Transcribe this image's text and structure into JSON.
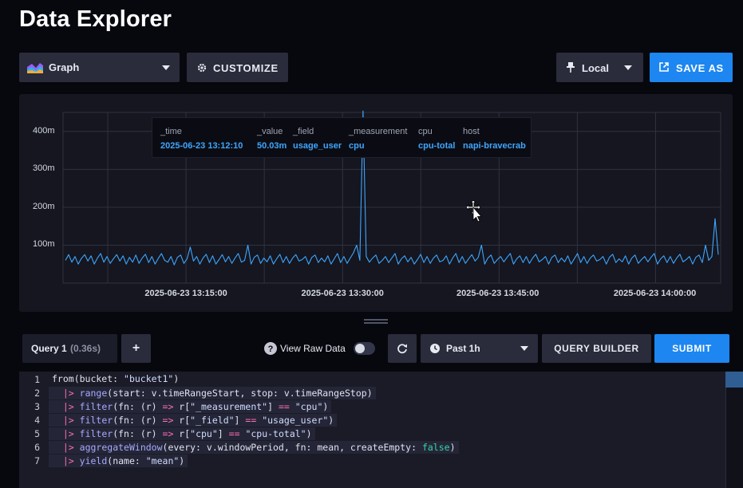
{
  "page": {
    "title": "Data Explorer"
  },
  "toolbar": {
    "graph_label": "Graph",
    "customize_label": "CUSTOMIZE",
    "local_label": "Local",
    "save_as_label": "SAVE AS"
  },
  "chart_data": {
    "type": "line",
    "ylim": [
      0,
      450
    ],
    "y_ticks": [
      {
        "value": 100,
        "label": "100m"
      },
      {
        "value": 200,
        "label": "200m"
      },
      {
        "value": 300,
        "label": "300m"
      },
      {
        "value": 400,
        "label": "400m"
      }
    ],
    "x_ticks": [
      {
        "value": 0.187,
        "label": "2025-06-23 13:15:00"
      },
      {
        "value": 0.425,
        "label": "2025-06-23 13:30:00"
      },
      {
        "value": 0.661,
        "label": "2025-06-23 13:45:00"
      },
      {
        "value": 0.9,
        "label": "2025-06-23 14:00:00"
      }
    ],
    "series": [
      {
        "color": "#3ea6ff",
        "values": [
          60,
          75,
          55,
          70,
          50,
          65,
          75,
          58,
          72,
          50,
          66,
          78,
          55,
          70,
          52,
          64,
          75,
          58,
          72,
          50,
          68,
          55,
          74,
          52,
          66,
          76,
          54,
          70,
          50,
          65,
          78,
          60,
          55,
          70,
          48,
          68,
          74,
          52,
          64,
          95,
          58,
          70,
          50,
          66,
          76,
          54,
          72,
          50,
          62,
          75,
          56,
          70,
          52,
          66,
          78,
          55,
          60,
          100,
          50,
          68,
          74,
          52,
          66,
          56,
          72,
          50,
          64,
          76,
          54,
          70,
          52,
          66,
          75,
          58,
          62,
          70,
          50,
          68,
          74,
          54,
          66,
          56,
          72,
          50,
          64,
          78,
          54,
          70,
          52,
          66,
          80,
          100,
          60,
          470,
          70,
          55,
          66,
          74,
          52,
          60,
          70,
          54,
          66,
          78,
          50,
          64,
          72,
          56,
          68,
          50,
          62,
          76,
          54,
          70,
          52,
          66,
          74,
          56,
          60,
          72,
          50,
          66,
          78,
          54,
          70,
          52,
          64,
          75,
          58,
          68,
          100,
          50,
          66,
          74,
          52,
          62,
          70,
          56,
          68,
          78,
          50,
          64,
          72,
          54,
          70,
          52,
          66,
          76,
          56,
          62,
          70,
          50,
          68,
          74,
          54,
          66,
          56,
          72,
          50,
          64,
          78,
          54,
          70,
          52,
          66,
          74,
          58,
          62,
          70,
          50,
          68,
          76,
          54,
          64,
          56,
          72,
          50,
          66,
          74,
          52,
          62,
          70,
          56,
          68,
          78,
          50,
          64,
          72,
          54,
          70,
          52,
          66,
          76,
          56,
          62,
          70,
          50,
          68,
          74,
          54,
          100,
          60,
          70,
          170,
          75
        ]
      }
    ]
  },
  "tooltip": {
    "columns": [
      {
        "header": "_time",
        "value": "2025-06-23 13:12:10"
      },
      {
        "header": "_value",
        "value": "50.03m"
      },
      {
        "header": "_field",
        "value": "usage_user"
      },
      {
        "header": "_measurement",
        "value": "cpu"
      },
      {
        "header": "cpu",
        "value": "cpu-total"
      },
      {
        "header": "host",
        "value": "napi-bravecrab"
      }
    ]
  },
  "query_bar": {
    "tab_label": "Query 1",
    "tab_time": "(0.36s)",
    "add_label": "+",
    "view_raw_label": "View Raw Data",
    "time_range_label": "Past 1h",
    "query_builder_label": "QUERY BUILDER",
    "submit_label": "SUBMIT"
  },
  "editor": {
    "lines": [
      {
        "num": "1",
        "tokens": [
          [
            "k-plain",
            "from(bucket: "
          ],
          [
            "k-str",
            "\"bucket1\""
          ],
          [
            "k-plain",
            ")"
          ]
        ]
      },
      {
        "num": "2",
        "tokens": [
          [
            "k-dots",
            "  "
          ],
          [
            "k-op",
            "|>"
          ],
          [
            "k-plain",
            " "
          ],
          [
            "k-fn",
            "range"
          ],
          [
            "k-plain",
            "(start: v.timeRangeStart, stop: v.timeRangeStop)"
          ]
        ]
      },
      {
        "num": "3",
        "tokens": [
          [
            "k-dots",
            "  "
          ],
          [
            "k-op",
            "|>"
          ],
          [
            "k-plain",
            " "
          ],
          [
            "k-fn",
            "filter"
          ],
          [
            "k-plain",
            "(fn: (r) "
          ],
          [
            "k-op",
            "=>"
          ],
          [
            "k-plain",
            " r["
          ],
          [
            "k-str",
            "\"_measurement\""
          ],
          [
            "k-plain",
            "] "
          ],
          [
            "k-op",
            "=="
          ],
          [
            "k-plain",
            " "
          ],
          [
            "k-str",
            "\"cpu\""
          ],
          [
            "k-plain",
            ")"
          ]
        ]
      },
      {
        "num": "4",
        "tokens": [
          [
            "k-dots",
            "  "
          ],
          [
            "k-op",
            "|>"
          ],
          [
            "k-plain",
            " "
          ],
          [
            "k-fn",
            "filter"
          ],
          [
            "k-plain",
            "(fn: (r) "
          ],
          [
            "k-op",
            "=>"
          ],
          [
            "k-plain",
            " r["
          ],
          [
            "k-str",
            "\"_field\""
          ],
          [
            "k-plain",
            "] "
          ],
          [
            "k-op",
            "=="
          ],
          [
            "k-plain",
            " "
          ],
          [
            "k-str",
            "\"usage_user\""
          ],
          [
            "k-plain",
            ")"
          ]
        ]
      },
      {
        "num": "5",
        "tokens": [
          [
            "k-dots",
            "  "
          ],
          [
            "k-op",
            "|>"
          ],
          [
            "k-plain",
            " "
          ],
          [
            "k-fn",
            "filter"
          ],
          [
            "k-plain",
            "(fn: (r) "
          ],
          [
            "k-op",
            "=>"
          ],
          [
            "k-plain",
            " r["
          ],
          [
            "k-str",
            "\"cpu\""
          ],
          [
            "k-plain",
            "] "
          ],
          [
            "k-op",
            "=="
          ],
          [
            "k-plain",
            " "
          ],
          [
            "k-str",
            "\"cpu-total\""
          ],
          [
            "k-plain",
            ")"
          ]
        ]
      },
      {
        "num": "6",
        "tokens": [
          [
            "k-dots",
            "  "
          ],
          [
            "k-op",
            "|>"
          ],
          [
            "k-plain",
            " "
          ],
          [
            "k-fn",
            "aggregateWindow"
          ],
          [
            "k-plain",
            "(every: v.windowPeriod, fn: mean, createEmpty: "
          ],
          [
            "k-bool",
            "false"
          ],
          [
            "k-plain",
            ")"
          ]
        ]
      },
      {
        "num": "7",
        "tokens": [
          [
            "k-dots",
            "  "
          ],
          [
            "k-op",
            "|>"
          ],
          [
            "k-plain",
            " "
          ],
          [
            "k-fn",
            "yield"
          ],
          [
            "k-plain",
            "(name: "
          ],
          [
            "k-str",
            "\"mean\""
          ],
          [
            "k-plain",
            ")"
          ]
        ]
      }
    ]
  },
  "colors": {
    "accent": "#1d86f0",
    "series": "#3ea6ff",
    "panel": "#15161f"
  }
}
